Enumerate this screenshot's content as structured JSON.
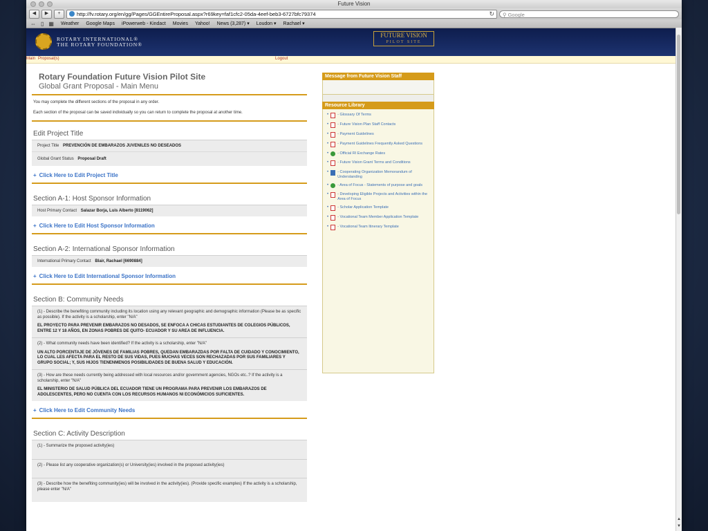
{
  "window": {
    "title": "Future Vision"
  },
  "browser": {
    "url": "http://fv.rotary.org/en/gg/Pages/GGEntireProposal.aspx?r69key=faf1cfc2-05da-4eef-beb3-6727bfc79374",
    "search_placeholder": "Google",
    "bookmarks": [
      "Weather",
      "Google Maps",
      "iPowerweb - Kindact",
      "Movies",
      "Yahoo!",
      "News (3,287) ▾",
      "Loudon ▾",
      "Rachael ▾"
    ]
  },
  "banner": {
    "org_line1": "ROTARY INTERNATIONAL®",
    "org_line2": "THE ROTARY FOUNDATION®",
    "fv_title": "FUTURE VISION",
    "fv_sub": "PILOT SITE"
  },
  "nav": {
    "main": "Main",
    "proposals": "Proposal(s)",
    "logout": "Logout"
  },
  "page": {
    "title": "Rotary Foundation Future Vision Pilot Site",
    "subtitle": "Global Grant Proposal - Main Menu",
    "intro1": "You may complete the different sections of the proposal in any order.",
    "intro2": "Each section of the proposal can be saved individually so you can return to complete the proposal at another time."
  },
  "sections": {
    "title": {
      "heading": "Edit Project Title",
      "project_title_label": "Project Title",
      "project_title_value": "PREVENCIÓN DE EMBARAZOS JUVENILES NO DESEADOS",
      "status_label": "Global Grant Status",
      "status_value": "Proposal Draft",
      "edit_link": "Click Here to Edit Project Title"
    },
    "host": {
      "heading": "Section A-1: Host Sponsor Information",
      "label": "Host Primary Contact",
      "value": "Salazar Borja, Luis Alberto [8119062]",
      "edit_link": "Click Here to Edit Host Sponsor Information"
    },
    "intl": {
      "heading": "Section A-2: International Sponsor Information",
      "label": "International Primary Contact",
      "value": "Blair, Rachael [6690884]",
      "edit_link": "Click Here to Edit International Sponsor Information"
    },
    "community": {
      "heading": "Section B: Community Needs",
      "q1": "(1) - Describe the benefiting community including its location using any relevant geographic and demographic information (Please be as specific as possible). If the activity is a scholarship, enter \"N/A\"",
      "a1": "EL PROYECTO PARA PREVENIR EMBARAZOS NO DESADOS, SE ENFOCA A CHICAS ESTUDIANTES DE COLEGIOS PÚBLICOS, ENTRE 12 Y 18 AÑOS, EN ZONAS POBRES DE QUITO- ECUADOR Y SU AREA DE INFLUENCIA.",
      "q2": "(2) - What community needs have been identified? If the activity is a scholarship, enter \"N/A\"",
      "a2": "UN ALTO PORCENTAJE DE JÓVENES DE FAMILIAS POBRES, QUEDAN EMBARAZDAS POR FALTA DE CUIDADO Y CONOCIMIENTO, LO CUAL LES AFECTA PARA EL RESTO DE SUS VIDAS, PUES MUCHAS VECES SON RECHAZADAS POR SUS FAMILIARES Y GRUPO SOCIAL; Y, SUS HIJOS TIENENMENOS POSIBILIDADES DE BUENA SALUD Y EDUCACIÓN.",
      "q3": "(3) - How are these needs currently being addressed with local resources and/or government agencies, NGOs etc..? If the activity is a scholarship, enter \"N/A\"",
      "a3": "EL MINISTERIO DE SALUD PÚBLICA DEL ECUADOR TIENE UN PROGRAMA PARA PREVENIR LOS EMBARAZOS DE ADOLESCENTES, PERO NO CUENTA CON LOS RECURSOS HUMANOS NI ECONÓMICIOS SUFICIENTES.",
      "edit_link": "Click Here to Edit Community Needs"
    },
    "activity": {
      "heading": "Section C: Activity Description",
      "q1": "(1) - Summarize the proposed activity(ies)",
      "q2": "(2) - Please list any cooperative organization(s) or University(ies) involved in the proposed activity(ies)",
      "q3": "(3) - Describe how the benefiting community(ies) will be involved in the activity(ies). (Provide specific examples) If the activity is a scholarship, please enter \"N/A\""
    }
  },
  "sidebar": {
    "message_heading": "Message from Future Vision Staff",
    "library_heading": "Resource Library",
    "items": [
      {
        "label": "- Glossary Of Terms",
        "icon": "pdf-icon"
      },
      {
        "label": "- Future Vision Plan Staff Contacts",
        "icon": "pdf-icon"
      },
      {
        "label": "- Payment Guidelines",
        "icon": "pdf-icon"
      },
      {
        "label": "- Payment Guidelines Frequently Asked Questions",
        "icon": "pdf-icon"
      },
      {
        "label": "- Official RI Exchange Rates",
        "icon": "globe-icon"
      },
      {
        "label": "- Future Vision Grant Terms and Conditions",
        "icon": "pdf-icon"
      },
      {
        "label": "- Cooperating Organization Memorandum of Understanding",
        "icon": "doc-icon"
      },
      {
        "label": "- Area of Focus - Statements of purpose and goals",
        "icon": "globe-icon"
      },
      {
        "label": "- Developing Eligible Projects and Activities within the Area of Focus",
        "icon": "pdf-icon"
      },
      {
        "label": "- Scholar Application Template",
        "icon": "pdf-icon"
      },
      {
        "label": "- Vocational Team Member Application Template",
        "icon": "pdf-icon"
      },
      {
        "label": "- Vocational Team Itinerary Template",
        "icon": "pdf-icon"
      }
    ]
  }
}
